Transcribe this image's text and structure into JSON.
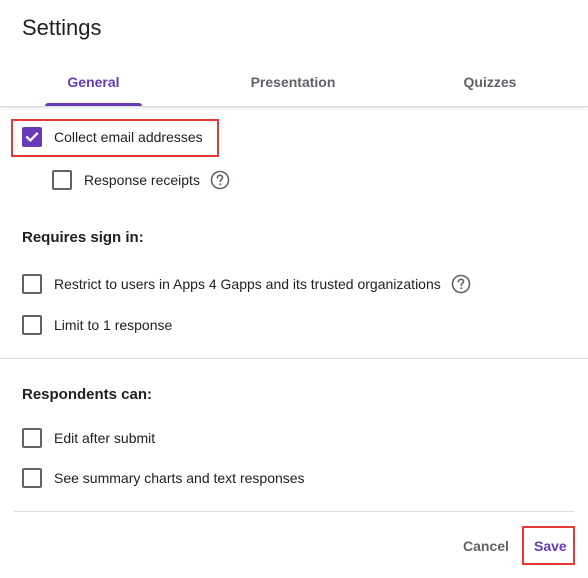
{
  "dialog": {
    "title": "Settings"
  },
  "tabs": [
    {
      "label": "General",
      "active": true
    },
    {
      "label": "Presentation",
      "active": false
    },
    {
      "label": "Quizzes",
      "active": false
    }
  ],
  "general": {
    "collect_email": {
      "label": "Collect email addresses",
      "checked": true
    },
    "response_receipts": {
      "label": "Response receipts",
      "checked": false,
      "icon": "help-icon"
    }
  },
  "sign_in": {
    "heading": "Requires sign in:",
    "restrict": {
      "label": "Restrict to users in Apps 4 Gapps and its trusted organizations",
      "checked": false,
      "icon": "help-icon"
    },
    "limit_one": {
      "label": "Limit to 1 response",
      "checked": false
    }
  },
  "respondents": {
    "heading": "Respondents can:",
    "edit_after": {
      "label": "Edit after submit",
      "checked": false
    },
    "see_summary": {
      "label": "See summary charts and text responses",
      "checked": false
    }
  },
  "footer": {
    "cancel_label": "Cancel",
    "save_label": "Save"
  },
  "colors": {
    "accent": "#673ab7",
    "highlight": "#e53935",
    "text": "#202124",
    "muted": "#5f6368"
  }
}
